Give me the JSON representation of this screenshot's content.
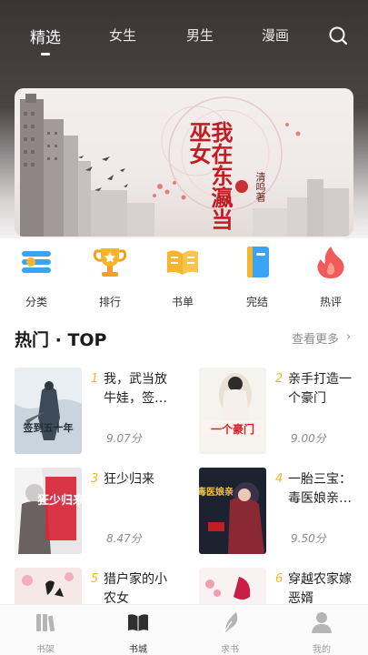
{
  "top_tabs": [
    {
      "label": "精选",
      "active": true
    },
    {
      "label": "女生"
    },
    {
      "label": "男生"
    },
    {
      "label": "漫画"
    }
  ],
  "banner": {
    "title": "我在东瀛当巫女",
    "author": "清鸣著"
  },
  "categories": [
    {
      "label": "分类",
      "icon": "category-icon"
    },
    {
      "label": "排行",
      "icon": "trophy-icon"
    },
    {
      "label": "书单",
      "icon": "open-book-icon"
    },
    {
      "label": "完结",
      "icon": "closed-book-icon"
    },
    {
      "label": "热评",
      "icon": "flame-icon"
    }
  ],
  "section": {
    "title": "热门 · TOP",
    "more": "查看更多",
    "more_chevron": "›"
  },
  "books": [
    {
      "rank": "1",
      "title": "我，武当放牛娃，签…",
      "score": "9.07分",
      "cover_text": "签到五十年"
    },
    {
      "rank": "2",
      "title": "亲手打造一个豪门",
      "score": "9.00分",
      "cover_text": "一个豪门"
    },
    {
      "rank": "3",
      "title": "狂少归来",
      "score": "8.47分",
      "cover_text": "狂少归来"
    },
    {
      "rank": "4",
      "title": "一胎三宝：毒医娘亲…",
      "score": "9.50分",
      "cover_text": "毒医娘亲"
    },
    {
      "rank": "5",
      "title": "猎户家的小农女",
      "score": ""
    },
    {
      "rank": "6",
      "title": "穿越农家嫁恶婿",
      "score": ""
    }
  ],
  "bottom_nav": [
    {
      "label": "书架",
      "icon": "bookshelf-icon"
    },
    {
      "label": "书城",
      "icon": "bookstore-icon",
      "active": true
    },
    {
      "label": "求书",
      "icon": "feather-icon"
    },
    {
      "label": "我的",
      "icon": "user-icon"
    }
  ],
  "colors": {
    "accent": "#f3b81e",
    "banner_red": "#c21d22",
    "category_blue": "#3aa4f3",
    "category_gold": "#f7b52b",
    "category_red": "#f05a5a"
  }
}
